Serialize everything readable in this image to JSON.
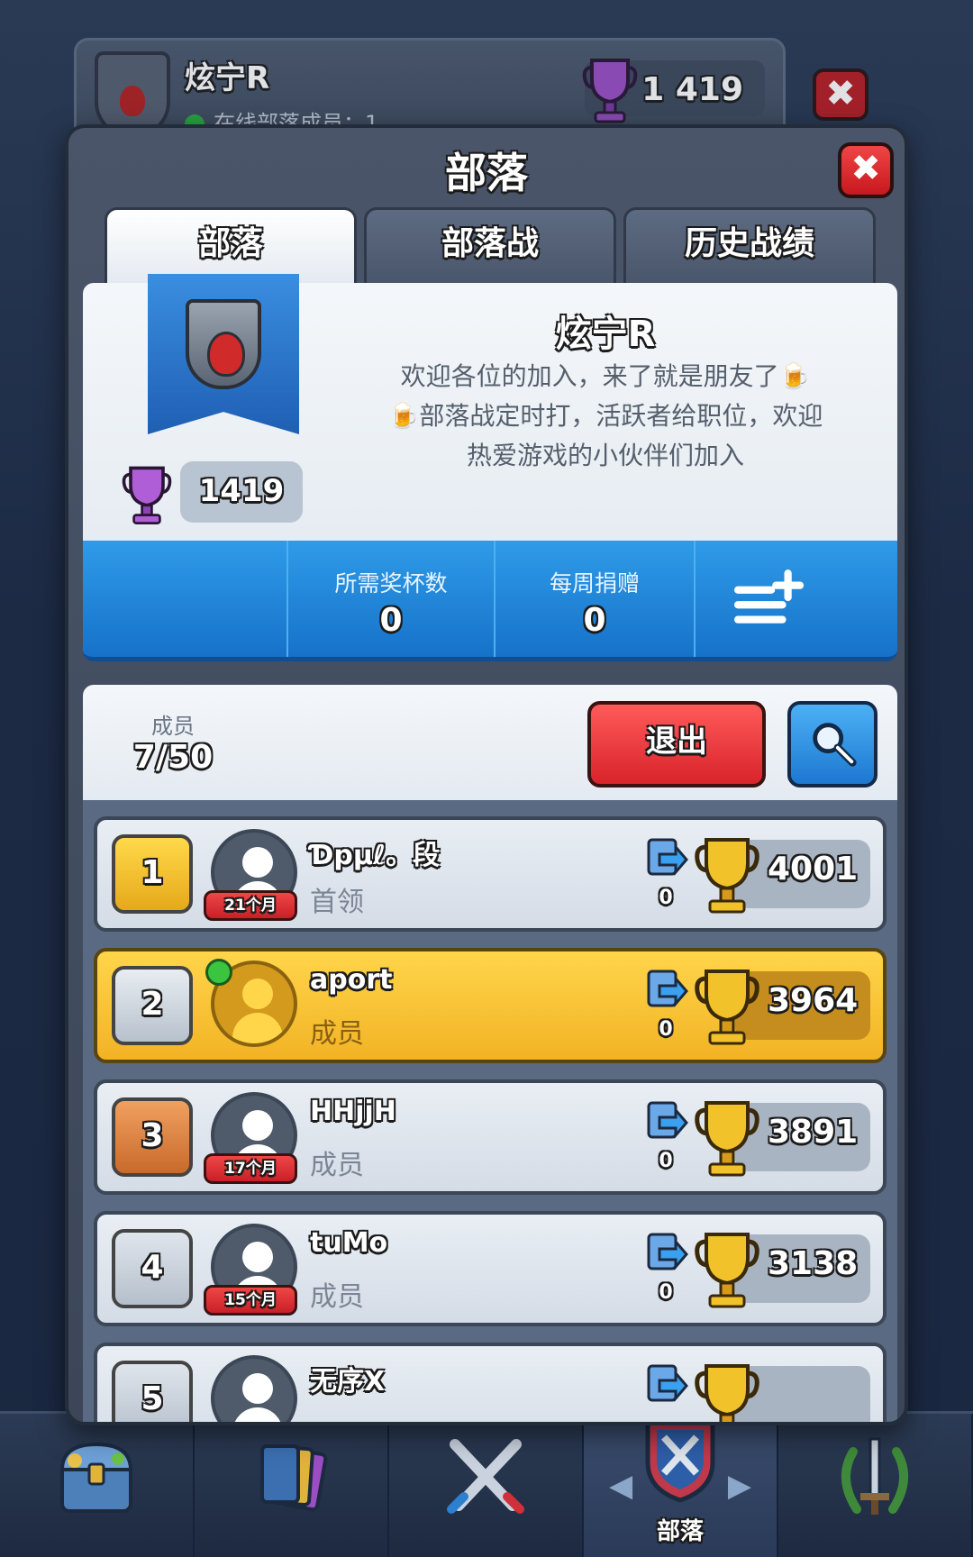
{
  "background_card": {
    "clan_name": "炫宁R",
    "online_text": "在线部落成员：1",
    "trophies": "1 419"
  },
  "modal": {
    "title": "部落",
    "close_symbol": "✖"
  },
  "tabs": [
    {
      "label": "部落",
      "active": true
    },
    {
      "label": "部落战",
      "active": false
    },
    {
      "label": "历史战绩",
      "active": false
    }
  ],
  "clan": {
    "name": "炫宁R",
    "description_lines": [
      "欢迎各位的加入，来了就是朋友了🍺",
      "🍺部落战定时打，活跃者给职位，欢迎",
      "热爱游戏的小伙伴们加入"
    ],
    "trophies": "1419",
    "badge_icon": "clan-badge-flame-icon"
  },
  "stats": {
    "required_trophies_label": "所需奖杯数",
    "required_trophies_value": "0",
    "weekly_donations_label": "每周捐赠",
    "weekly_donations_value": "0"
  },
  "members_header": {
    "label": "成员",
    "count": "7/50",
    "leave_label": "退出"
  },
  "members": [
    {
      "rank": "1",
      "name": "Ɗpµℓ。段",
      "role": "首领",
      "tenure": "21个月",
      "donations": "0",
      "trophies": "4001",
      "online": false,
      "me": false
    },
    {
      "rank": "2",
      "name": "aport",
      "role": "成员",
      "tenure": "",
      "donations": "0",
      "trophies": "3964",
      "online": true,
      "me": true
    },
    {
      "rank": "3",
      "name": "HHjjH",
      "role": "成员",
      "tenure": "17个月",
      "donations": "0",
      "trophies": "3891",
      "online": false,
      "me": false
    },
    {
      "rank": "4",
      "name": "tuMo",
      "role": "成员",
      "tenure": "15个月",
      "donations": "0",
      "trophies": "3138",
      "online": false,
      "me": false
    },
    {
      "rank": "5",
      "name": "无序X",
      "role": "",
      "tenure": "",
      "donations": "",
      "trophies": "",
      "online": false,
      "me": false
    }
  ],
  "bottom_nav": [
    {
      "icon": "treasure-chest-icon",
      "label": ""
    },
    {
      "icon": "cards-icon",
      "label": ""
    },
    {
      "icon": "crossed-swords-icon",
      "label": ""
    },
    {
      "icon": "clan-shield-icon",
      "label": "部落",
      "active": true
    },
    {
      "icon": "laurel-sword-icon",
      "label": ""
    }
  ],
  "colors": {
    "primary_blue": "#1f7fd6",
    "leave_red": "#d8232a",
    "highlight_gold": "#f2b325",
    "trophy_gold": "#e8b22a",
    "clan_trophy_purple": "#9b4ec4"
  }
}
